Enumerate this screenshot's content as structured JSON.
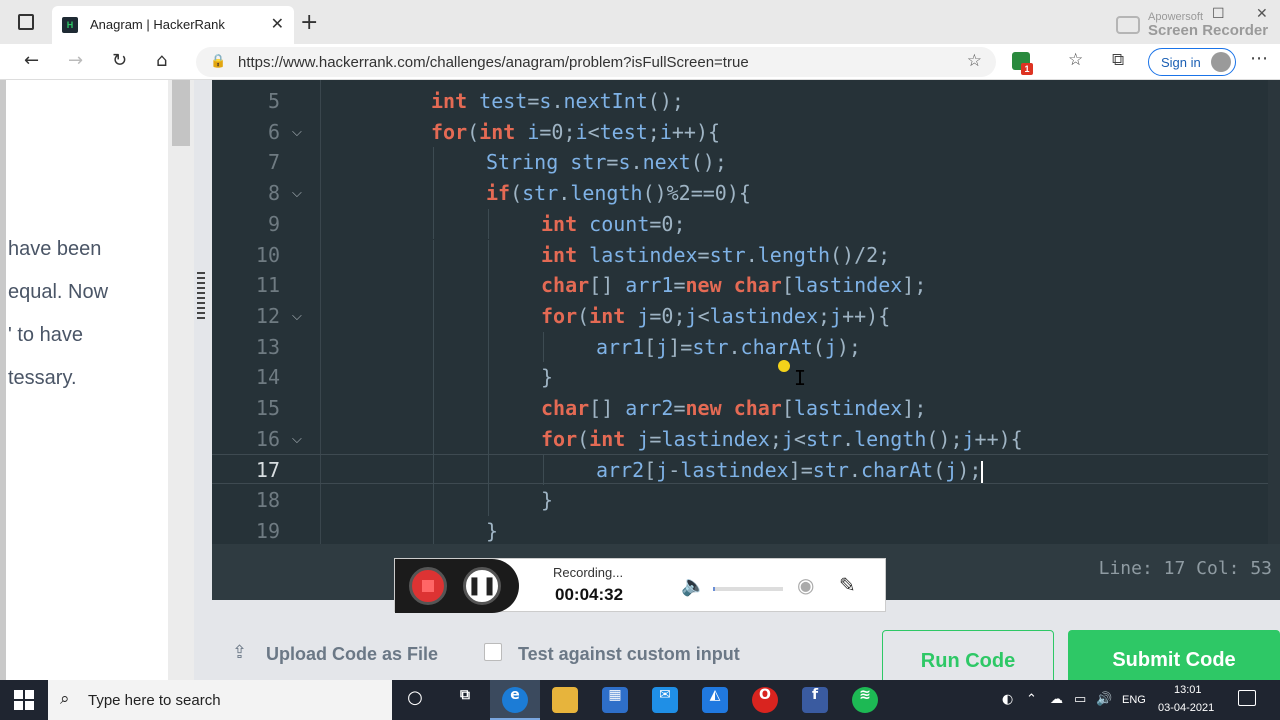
{
  "browser": {
    "tab_title": "Anagram | HackerRank",
    "tab_favicon_text": "H",
    "url": "https://www.hackerrank.com/challenges/anagram/problem?isFullScreen=true",
    "signin_label": "Sign in",
    "extension_badge": "1",
    "watermark_line1": "Apowersoft",
    "watermark_line2": "Screen Recorder"
  },
  "problem_text": {
    "lines": [
      "have been",
      "equal. Now",
      "' to have",
      "tessary."
    ]
  },
  "editor": {
    "lines": [
      {
        "num": "5",
        "fold": false,
        "indent": 0,
        "tokens": [
          [
            "kw",
            "int"
          ],
          [
            "t",
            " "
          ],
          [
            "id",
            "test"
          ],
          [
            "t",
            "="
          ],
          [
            "id",
            "s"
          ],
          [
            "t",
            "."
          ],
          [
            "fn",
            "nextInt"
          ],
          [
            "t",
            "();"
          ]
        ]
      },
      {
        "num": "6",
        "fold": true,
        "indent": 0,
        "tokens": [
          [
            "kw",
            "for"
          ],
          [
            "t",
            "("
          ],
          [
            "kw",
            "int"
          ],
          [
            "t",
            " "
          ],
          [
            "id",
            "i"
          ],
          [
            "t",
            "=0;"
          ],
          [
            "id",
            "i"
          ],
          [
            "t",
            "<"
          ],
          [
            "id",
            "test"
          ],
          [
            "t",
            ";"
          ],
          [
            "id",
            "i"
          ],
          [
            "t",
            "++){"
          ]
        ]
      },
      {
        "num": "7",
        "fold": false,
        "indent": 1,
        "tokens": [
          [
            "id",
            "String"
          ],
          [
            "t",
            " "
          ],
          [
            "id",
            "str"
          ],
          [
            "t",
            "="
          ],
          [
            "id",
            "s"
          ],
          [
            "t",
            "."
          ],
          [
            "fn",
            "next"
          ],
          [
            "t",
            "();"
          ]
        ]
      },
      {
        "num": "8",
        "fold": true,
        "indent": 1,
        "tokens": [
          [
            "kw",
            "if"
          ],
          [
            "t",
            "("
          ],
          [
            "id",
            "str"
          ],
          [
            "t",
            "."
          ],
          [
            "fn",
            "length"
          ],
          [
            "t",
            "()%2==0){"
          ]
        ]
      },
      {
        "num": "9",
        "fold": false,
        "indent": 2,
        "tokens": [
          [
            "kw",
            "int"
          ],
          [
            "t",
            " "
          ],
          [
            "id",
            "count"
          ],
          [
            "t",
            "=0;"
          ]
        ]
      },
      {
        "num": "10",
        "fold": false,
        "indent": 2,
        "tokens": [
          [
            "kw",
            "int"
          ],
          [
            "t",
            " "
          ],
          [
            "id",
            "lastindex"
          ],
          [
            "t",
            "="
          ],
          [
            "id",
            "str"
          ],
          [
            "t",
            "."
          ],
          [
            "fn",
            "length"
          ],
          [
            "t",
            "()/2;"
          ]
        ]
      },
      {
        "num": "11",
        "fold": false,
        "indent": 2,
        "tokens": [
          [
            "kw",
            "char"
          ],
          [
            "t",
            "[] "
          ],
          [
            "id",
            "arr1"
          ],
          [
            "t",
            "="
          ],
          [
            "kw",
            "new"
          ],
          [
            "t",
            " "
          ],
          [
            "kw",
            "char"
          ],
          [
            "t",
            "["
          ],
          [
            "id",
            "lastindex"
          ],
          [
            "t",
            "];"
          ]
        ]
      },
      {
        "num": "12",
        "fold": true,
        "indent": 2,
        "tokens": [
          [
            "kw",
            "for"
          ],
          [
            "t",
            "("
          ],
          [
            "kw",
            "int"
          ],
          [
            "t",
            " "
          ],
          [
            "id",
            "j"
          ],
          [
            "t",
            "=0;"
          ],
          [
            "id",
            "j"
          ],
          [
            "t",
            "<"
          ],
          [
            "id",
            "lastindex"
          ],
          [
            "t",
            ";"
          ],
          [
            "id",
            "j"
          ],
          [
            "t",
            "++){"
          ]
        ]
      },
      {
        "num": "13",
        "fold": false,
        "indent": 3,
        "tokens": [
          [
            "id",
            "arr1"
          ],
          [
            "t",
            "["
          ],
          [
            "id",
            "j"
          ],
          [
            "t",
            "]="
          ],
          [
            "id",
            "str"
          ],
          [
            "t",
            "."
          ],
          [
            "fn",
            "charAt"
          ],
          [
            "t",
            "("
          ],
          [
            "id",
            "j"
          ],
          [
            "t",
            ");"
          ]
        ]
      },
      {
        "num": "14",
        "fold": false,
        "indent": 2,
        "tokens": [
          [
            "t",
            "}"
          ]
        ]
      },
      {
        "num": "15",
        "fold": false,
        "indent": 2,
        "tokens": [
          [
            "kw",
            "char"
          ],
          [
            "t",
            "[] "
          ],
          [
            "id",
            "arr2"
          ],
          [
            "t",
            "="
          ],
          [
            "kw",
            "new"
          ],
          [
            "t",
            " "
          ],
          [
            "kw",
            "char"
          ],
          [
            "t",
            "["
          ],
          [
            "id",
            "lastindex"
          ],
          [
            "t",
            "];"
          ]
        ]
      },
      {
        "num": "16",
        "fold": true,
        "indent": 2,
        "tokens": [
          [
            "kw",
            "for"
          ],
          [
            "t",
            "("
          ],
          [
            "kw",
            "int"
          ],
          [
            "t",
            " "
          ],
          [
            "id",
            "j"
          ],
          [
            "t",
            "="
          ],
          [
            "id",
            "lastindex"
          ],
          [
            "t",
            ";"
          ],
          [
            "id",
            "j"
          ],
          [
            "t",
            "<"
          ],
          [
            "id",
            "str"
          ],
          [
            "t",
            "."
          ],
          [
            "fn",
            "length"
          ],
          [
            "t",
            "();"
          ],
          [
            "id",
            "j"
          ],
          [
            "t",
            "++){"
          ]
        ]
      },
      {
        "num": "17",
        "fold": false,
        "indent": 3,
        "active": true,
        "tokens": [
          [
            "id",
            "arr2"
          ],
          [
            "t",
            "["
          ],
          [
            "id",
            "j"
          ],
          [
            "t",
            "-"
          ],
          [
            "id",
            "lastindex"
          ],
          [
            "t",
            "]="
          ],
          [
            "id",
            "str"
          ],
          [
            "t",
            "."
          ],
          [
            "fn",
            "charAt"
          ],
          [
            "t",
            "("
          ],
          [
            "id",
            "j"
          ],
          [
            "t",
            ");"
          ]
        ]
      },
      {
        "num": "18",
        "fold": false,
        "indent": 2,
        "tokens": [
          [
            "t",
            "}"
          ]
        ]
      },
      {
        "num": "19",
        "fold": false,
        "indent": 1,
        "tokens": [
          [
            "t",
            "}"
          ]
        ]
      }
    ],
    "status": "Line: 17 Col: 53"
  },
  "recorder": {
    "status": "Recording...",
    "time": "00:04:32",
    "volume_level": 0.03
  },
  "actions": {
    "upload_label": "Upload Code as File",
    "custom_input_label": "Test against custom input",
    "run_label": "Run Code",
    "submit_label": "Submit Code"
  },
  "taskbar": {
    "search_placeholder": "Type here to search",
    "language": "ENG",
    "time": "13:01",
    "date": "03-04-2021"
  },
  "colors": {
    "editor_bg": "#263238",
    "keyword": "#e46a54",
    "identifier": "#7fb2e6",
    "accent_green": "#2ec866"
  }
}
